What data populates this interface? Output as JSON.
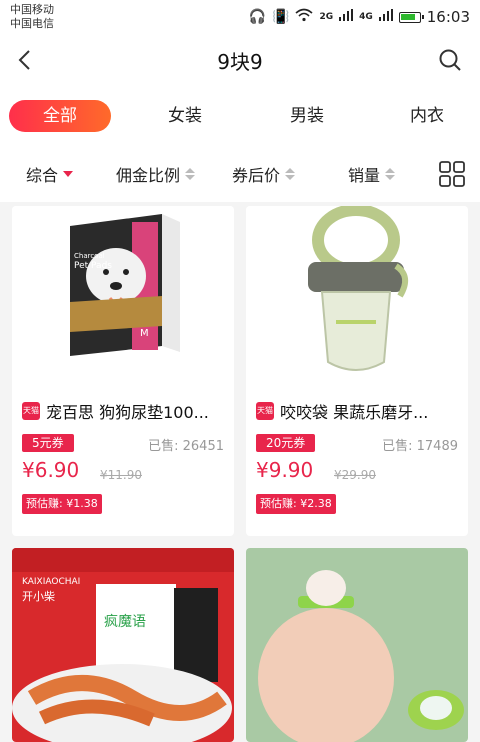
{
  "status_bar": {
    "carrier1": "中国移动",
    "carrier2": "中国电信",
    "network1": "2G",
    "network2": "4G",
    "time": "16:03"
  },
  "header": {
    "title": "9块9"
  },
  "tabs": [
    {
      "label": "全部",
      "active": true
    },
    {
      "label": "女装"
    },
    {
      "label": "男装"
    },
    {
      "label": "内衣"
    }
  ],
  "sort": [
    {
      "label": "综合"
    },
    {
      "label": "佣金比例"
    },
    {
      "label": "券后价"
    },
    {
      "label": "销量"
    }
  ],
  "products": [
    {
      "title": "宠百思 狗狗尿垫100...",
      "badge": "天猫",
      "coupon": "5元券",
      "sold": "已售: 26451",
      "price": "¥6.90",
      "old_price": "¥11.90",
      "earn": "预估赚: ¥1.38",
      "image_text": {
        "brand_line": "Charcoal",
        "title_line": "Pet Pads",
        "size": "M"
      }
    },
    {
      "title": "咬咬袋 果蔬乐磨牙...",
      "badge": "天猫",
      "coupon": "20元券",
      "sold": "已售: 17489",
      "price": "¥9.90",
      "old_price": "¥29.90",
      "earn": "预估赚: ¥2.38"
    },
    {
      "image_text": {
        "brand": "KAIXIAOCHAI",
        "brand_cn": "开小柴",
        "bag": "疯魔语"
      }
    },
    {}
  ],
  "colors": {
    "accent": "#e8254b",
    "gradient_end": "#ff6a2a",
    "background": "#f4f4f4"
  }
}
